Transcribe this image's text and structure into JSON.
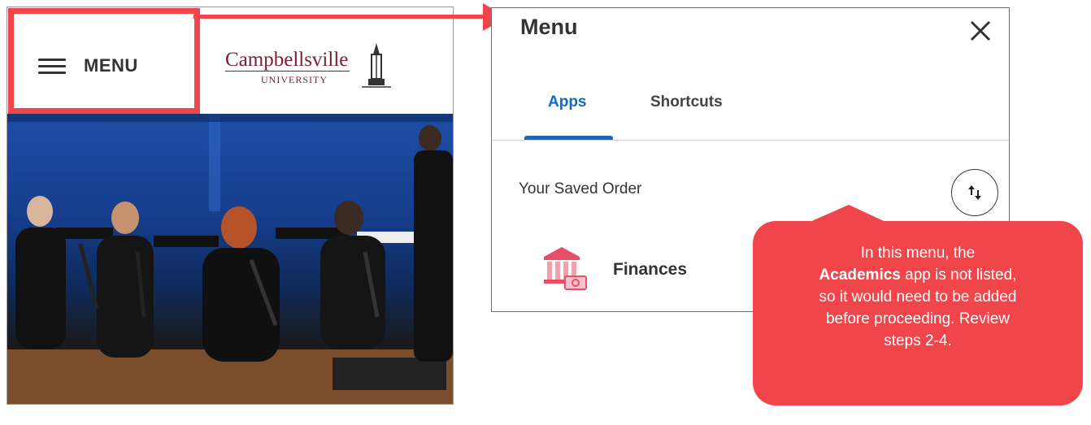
{
  "mobile_page": {
    "menu_label": "MENU",
    "logo": {
      "name": "Campbellsville",
      "subtitle": "UNIVERSITY"
    }
  },
  "menu_panel": {
    "title": "Menu",
    "tabs": [
      {
        "label": "Apps",
        "active": true
      },
      {
        "label": "Shortcuts",
        "active": false
      }
    ],
    "saved_order_label": "Your Saved Order",
    "apps": [
      {
        "label": "Finances",
        "icon": "bank-icon"
      }
    ]
  },
  "callout": {
    "line_1": "In this menu, the",
    "bold_word": "Academics",
    "line_2_rest": " app is not listed,",
    "line_3": "so it would need to be added",
    "line_4": "before proceeding. Review",
    "line_5": "steps 2-4."
  },
  "colors": {
    "annotation_red": "#f0454b",
    "active_tab_blue": "#0d6ad0",
    "logo_maroon": "#7a1f35",
    "icon_pink": "#e8506a"
  }
}
